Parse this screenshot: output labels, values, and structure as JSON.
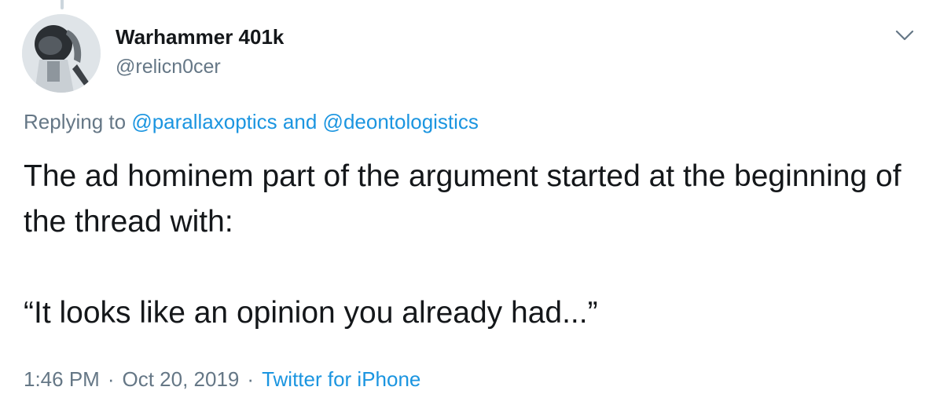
{
  "tweet": {
    "author": {
      "display_name": "Warhammer 401k",
      "handle": "@relicn0cer",
      "avatar_icon": "avatar-image"
    },
    "menu_icon": "chevron-down-icon",
    "reply": {
      "prefix": "Replying to",
      "mention_1": "@parallaxoptics",
      "conjunction": "and",
      "mention_2": "@deontologistics"
    },
    "text": {
      "line_1": "The ad hominem part of the argument started at the beginning of the thread with:",
      "line_2": "“It looks like an opinion you already had...”"
    },
    "meta": {
      "time": "1:46 PM",
      "date": "Oct 20, 2019",
      "separator": "·",
      "source": "Twitter for iPhone"
    }
  },
  "colors": {
    "text": "#14171a",
    "secondary": "#657786",
    "link": "#1b95e0",
    "thread_line": "#ccd6dd"
  }
}
